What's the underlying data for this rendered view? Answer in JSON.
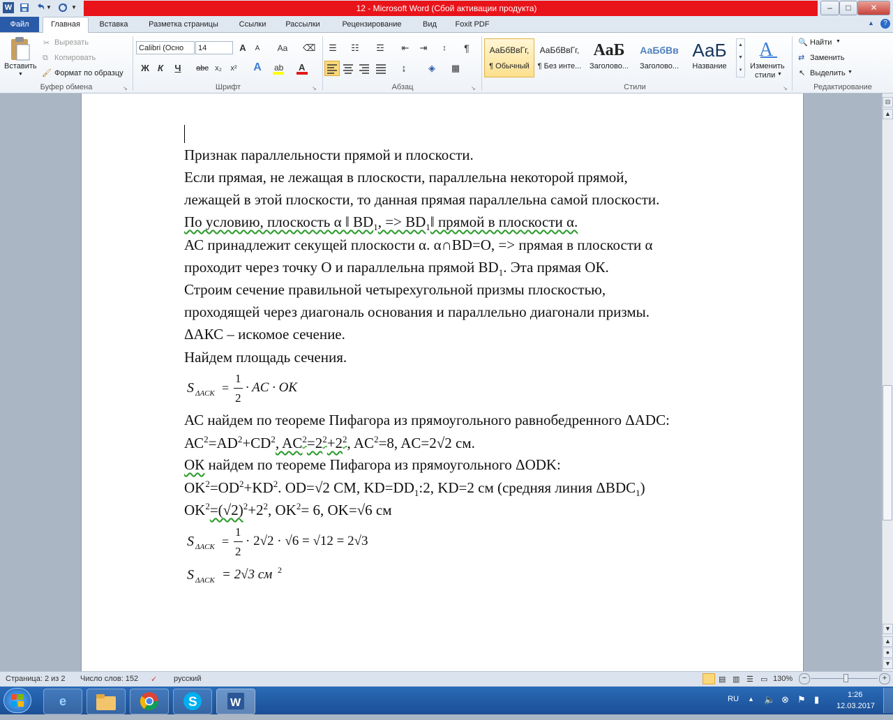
{
  "window": {
    "title": "12  -  Microsoft Word (Сбой активации продукта)",
    "minimize": "–",
    "maximize": "□",
    "close": "✕"
  },
  "tabs": {
    "file": "Файл",
    "home": "Главная",
    "insert": "Вставка",
    "layout": "Разметка страницы",
    "references": "Ссылки",
    "mailings": "Рассылки",
    "review": "Рецензирование",
    "view": "Вид",
    "foxit": "Foxit PDF"
  },
  "clipboard": {
    "paste": "Вставить",
    "cut": "Вырезать",
    "copy": "Копировать",
    "format_painter": "Формат по образцу",
    "group": "Буфер обмена"
  },
  "font": {
    "name": "Calibri (Осно",
    "size": "14",
    "group": "Шрифт",
    "bold": "Ж",
    "italic": "К",
    "underline": "Ч",
    "strike": "abc",
    "sub": "x₂",
    "sup": "x²",
    "grow": "A",
    "shrink": "A",
    "case": "Aa"
  },
  "paragraph": {
    "group": "Абзац",
    "pilcrow": "¶"
  },
  "styles": {
    "group": "Стили",
    "items": [
      {
        "sample": "АаБбВвГг,",
        "name": "¶ Обычный"
      },
      {
        "sample": "АаБбВвГг,",
        "name": "¶ Без инте..."
      },
      {
        "sample": "АаБ",
        "name": "Заголово..."
      },
      {
        "sample": "АаБбВв",
        "name": "Заголово..."
      },
      {
        "sample": "АаБ",
        "name": "Название"
      }
    ],
    "change_line1": "Изменить",
    "change_line2": "стили"
  },
  "editing": {
    "group": "Редактирование",
    "find": "Найти",
    "replace": "Заменить",
    "select": "Выделить"
  },
  "document": {
    "l1": "Признак параллельности прямой и плоскости.",
    "l2": "Если прямая, не лежащая в плоскости, параллельна некоторой прямой,",
    "l3": "лежащей в этой плоскости, то данная прямая параллельна самой плоскости.",
    "l4a": "По условию, плоскость α ‖ BD",
    "l4b": "1",
    "l4c": ", => BD",
    "l4d": "1",
    "l4e": "‖ прямой в плоскости α.",
    "l5": "АС принадлежит секущей плоскости α.  α∩BD=O, => прямая в плоскости α",
    "l6a": "проходит через точку О и параллельна прямой BD",
    "l6b": "1",
    "l6c": ". Эта прямая ОК.",
    "l7": "Строим сечение правильной четырехугольной призмы плоскостью,",
    "l8": "проходящей через диагональ основания и параллельно диагонали призмы.",
    "l9": "ΔАКС – искомое сечение.",
    "l10": "Найдем площадь сечения.",
    "eq1_s": "S",
    "eq1_sub": "ΔACK",
    "eq1_eq": "=",
    "eq1_num": "1",
    "eq1_den": "2",
    "eq1_rest": "· AC · OK",
    "l11": "АС найдем по теореме Пифагора из прямоугольного равнобедренного ΔADC:",
    "l12a": "АС",
    "l12b": "2",
    "l12c": "=AD",
    "l12d": "2",
    "l12e": "+CD",
    "l12f": "2",
    "l12g": ",  AC",
    "l12h": "2",
    "l12i": "=2",
    "l12j": "2",
    "l12k": "+2",
    "l12l": "2",
    "l12m": ",  AC",
    "l12n": "2",
    "l12o": "=8,  AC=2√2 см.",
    "l13a": "ОК",
    "l13b": " найдем по теореме Пифагора из прямоугольного ΔODK:",
    "l14a": "OK",
    "l14b": "2",
    "l14c": "=OD",
    "l14d": "2",
    "l14e": "+KD",
    "l14f": "2",
    "l14g": ". OD=√2 СМ, KD=DD",
    "l14h": "1",
    "l14i": ":2, KD=2 см (средняя линия ΔBDC",
    "l14j": "1",
    "l14k": ")",
    "l15a": "OK",
    "l15b": "2",
    "l15c": "=(√2)",
    "l15d": "2",
    "l15e": "+2",
    "l15f": "2",
    "l15g": ",  OK",
    "l15h": "2",
    "l15i": "= 6,  OK=√6 см",
    "eq2_s": "S",
    "eq2_sub": "ΔACK",
    "eq2_eq": "=",
    "eq2_num": "1",
    "eq2_den": "2",
    "eq2_rest": "· 2√2 · √6 = √12 = 2√3",
    "eq3_s": "S",
    "eq3_sub": "ΔACK",
    "eq3_rest": "= 2√3 см",
    "eq3_sup": "2"
  },
  "status": {
    "page": "Страница: 2 из 2",
    "words": "Число слов: 152",
    "lang": "русский",
    "zoom": "130%",
    "zoom_minus": "−",
    "zoom_plus": "+"
  },
  "taskbar": {
    "lang": "RU",
    "time": "1:26",
    "date": "12.03.2017",
    "word_label": "W"
  }
}
